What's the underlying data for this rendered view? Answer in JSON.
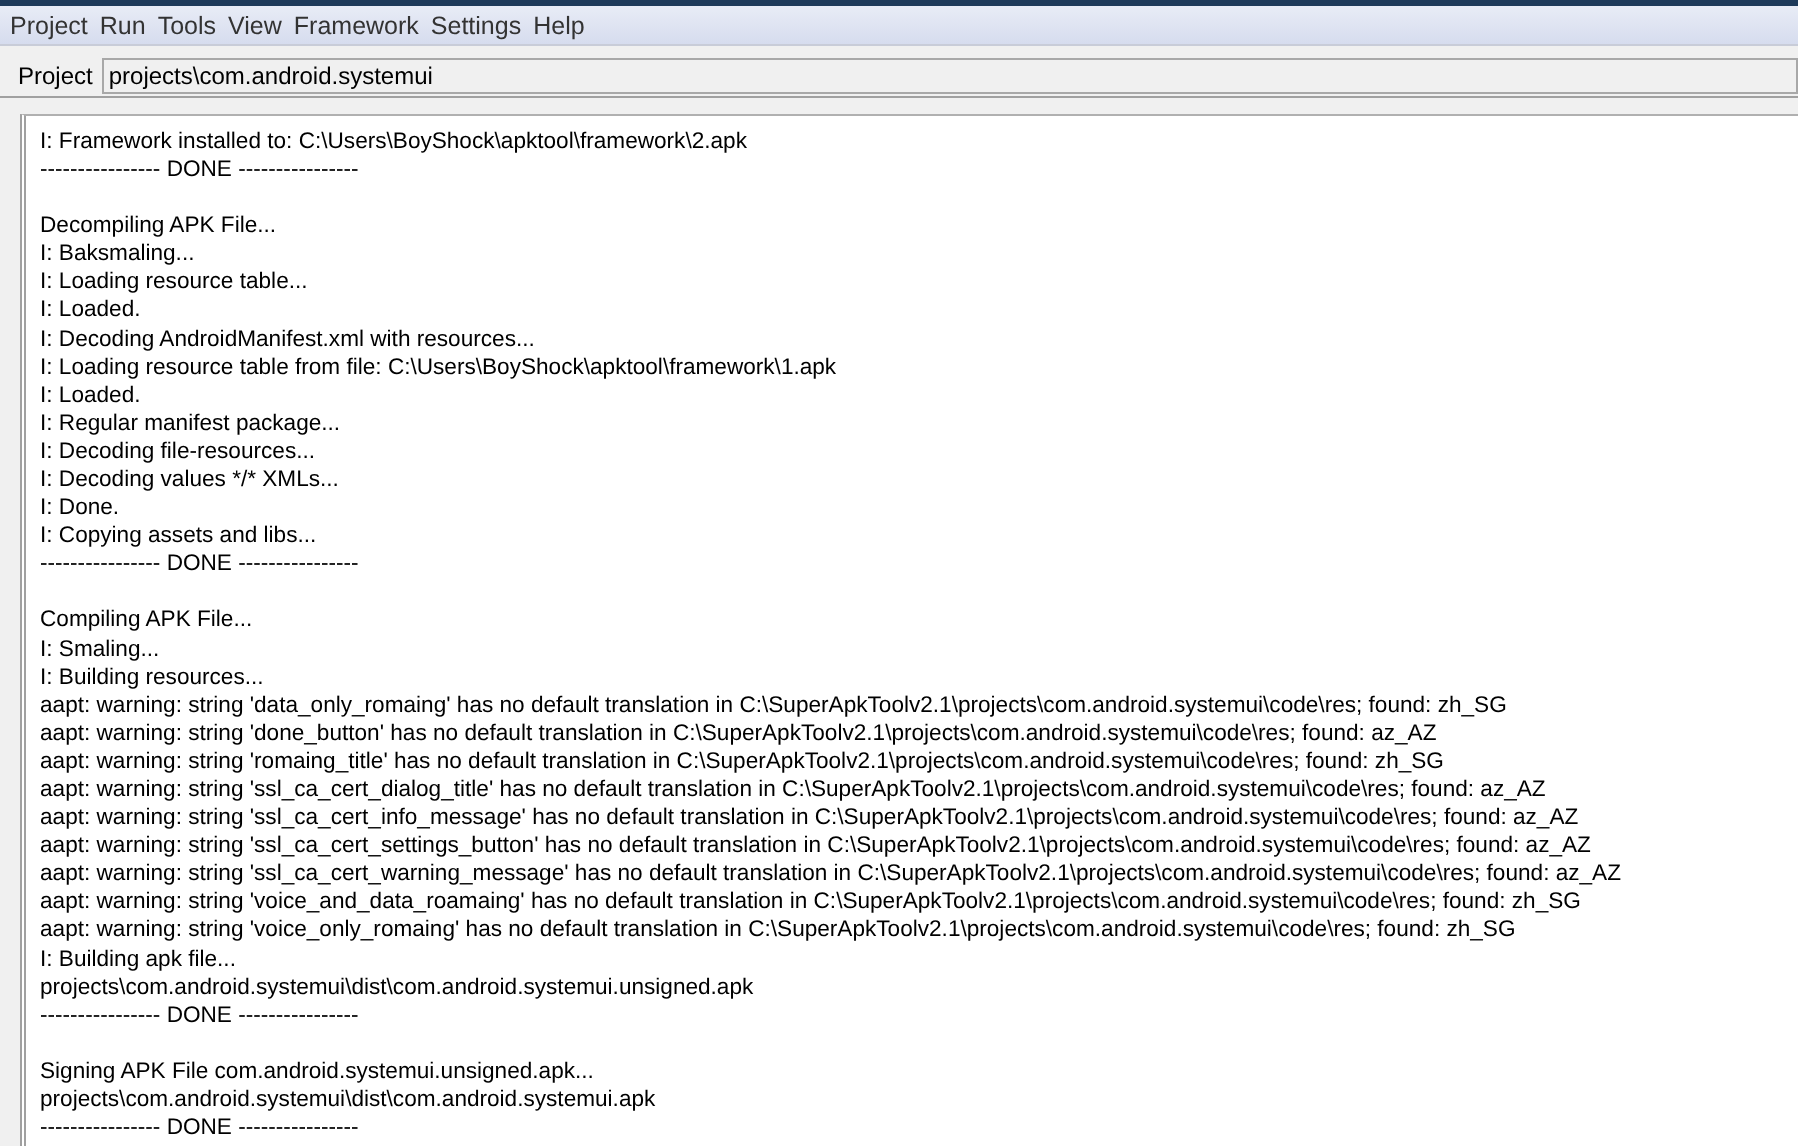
{
  "menu": [
    "Project",
    "Run",
    "Tools",
    "View",
    "Framework",
    "Settings",
    "Help"
  ],
  "project": {
    "label": "Project",
    "value": "projects\\com.android.systemui"
  },
  "log": [
    [
      "I: Framework installed to: C:\\Users\\BoyShock\\apktool\\framework\\2.apk",
      "---------------- DONE ----------------"
    ],
    [
      "Decompiling APK File...",
      "I: Baksmaling...",
      "I: Loading resource table...",
      "I: Loaded.",
      "I: Decoding AndroidManifest.xml with resources...",
      "I: Loading resource table from file: C:\\Users\\BoyShock\\apktool\\framework\\1.apk",
      "I: Loaded.",
      "I: Regular manifest package...",
      "I: Decoding file-resources...",
      "I: Decoding values */* XMLs...",
      "I: Done.",
      "I: Copying assets and libs...",
      "---------------- DONE ----------------"
    ],
    [
      "Compiling APK File...",
      "I: Smaling...",
      "I: Building resources...",
      "aapt: warning: string 'data_only_romaing' has no default translation in C:\\SuperApkToolv2.1\\projects\\com.android.systemui\\code\\res; found: zh_SG",
      "aapt: warning: string 'done_button' has no default translation in C:\\SuperApkToolv2.1\\projects\\com.android.systemui\\code\\res; found: az_AZ",
      "aapt: warning: string 'romaing_title' has no default translation in C:\\SuperApkToolv2.1\\projects\\com.android.systemui\\code\\res; found: zh_SG",
      "aapt: warning: string 'ssl_ca_cert_dialog_title' has no default translation in C:\\SuperApkToolv2.1\\projects\\com.android.systemui\\code\\res; found: az_AZ",
      "aapt: warning: string 'ssl_ca_cert_info_message' has no default translation in C:\\SuperApkToolv2.1\\projects\\com.android.systemui\\code\\res; found: az_AZ",
      "aapt: warning: string 'ssl_ca_cert_settings_button' has no default translation in C:\\SuperApkToolv2.1\\projects\\com.android.systemui\\code\\res; found: az_AZ",
      "aapt: warning: string 'ssl_ca_cert_warning_message' has no default translation in C:\\SuperApkToolv2.1\\projects\\com.android.systemui\\code\\res; found: az_AZ",
      "aapt: warning: string 'voice_and_data_roamaing' has no default translation in C:\\SuperApkToolv2.1\\projects\\com.android.systemui\\code\\res; found: zh_SG",
      "aapt: warning: string 'voice_only_romaing' has no default translation in C:\\SuperApkToolv2.1\\projects\\com.android.systemui\\code\\res; found: zh_SG",
      "I: Building apk file...",
      "projects\\com.android.systemui\\dist\\com.android.systemui.unsigned.apk",
      "---------------- DONE ----------------"
    ],
    [
      "Signing APK File com.android.systemui.unsigned.apk...",
      "projects\\com.android.systemui\\dist\\com.android.systemui.apk",
      "---------------- DONE ----------------"
    ]
  ]
}
